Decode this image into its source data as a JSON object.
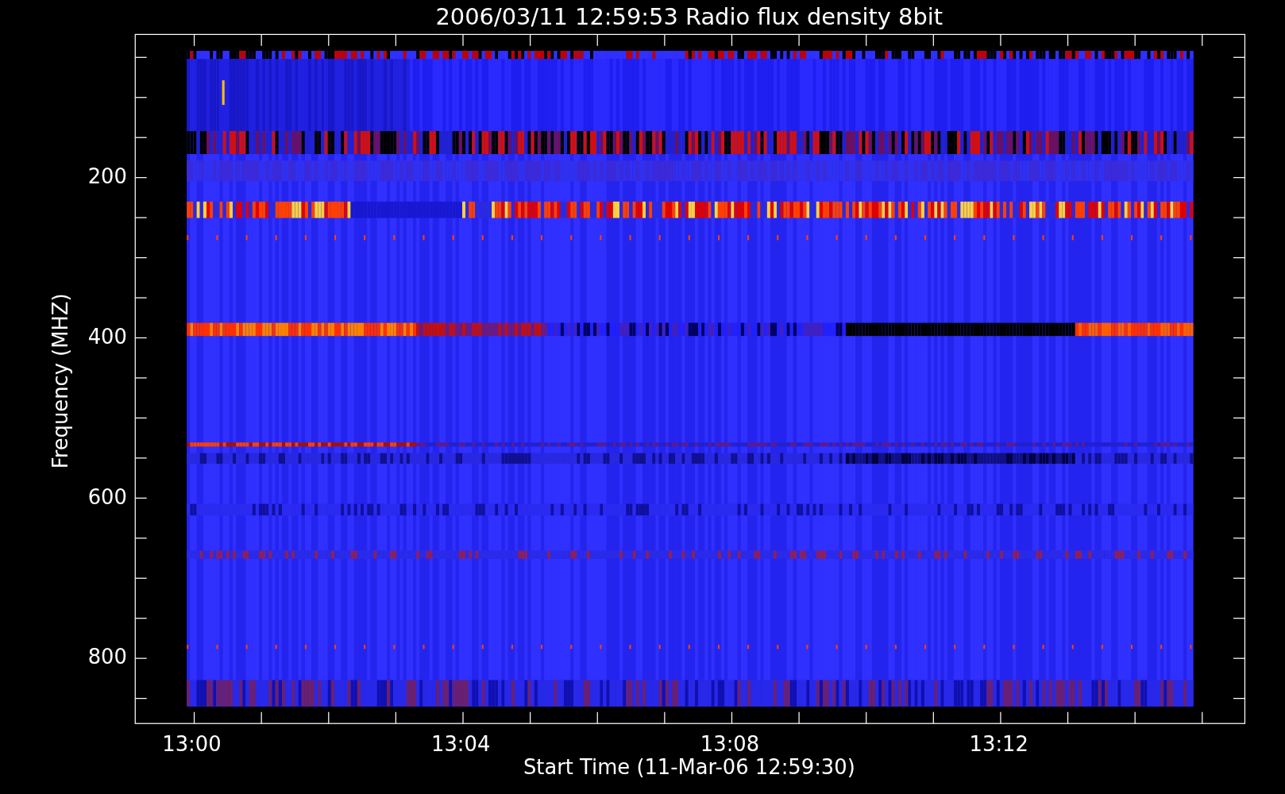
{
  "title": "2006/03/11 12:59:53 Radio flux density 8bit",
  "y_axis": {
    "label": "Frequency (MHZ)",
    "ticks": [
      "200",
      "400",
      "600",
      "800"
    ]
  },
  "x_axis": {
    "label": "Start Time (11-Mar-06 12:59:30)",
    "ticks": [
      "13:00",
      "13:04",
      "13:08",
      "13:12"
    ]
  }
}
